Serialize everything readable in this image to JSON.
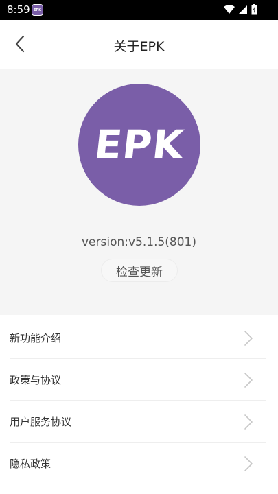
{
  "status_bar": {
    "time": "8:59",
    "app_icon_text": "EPK",
    "icons": [
      "wifi-icon",
      "signal-icon",
      "battery-icon"
    ]
  },
  "nav": {
    "title": "关于EPK",
    "back_icon": "chevron-left-icon"
  },
  "logo": {
    "text": "EPK",
    "color": "#7a5ea8"
  },
  "version": "version:v5.1.5(801)",
  "check_update_label": "检查更新",
  "menu": [
    {
      "label": "新功能介绍",
      "icon": "chevron-right-icon"
    },
    {
      "label": "政策与协议",
      "icon": "chevron-right-icon"
    },
    {
      "label": "用户服务协议",
      "icon": "chevron-right-icon"
    },
    {
      "label": "隐私政策",
      "icon": "chevron-right-icon"
    }
  ],
  "colors": {
    "accent": "#7a5ea8",
    "header_bg": "#f5f5f5",
    "status_bar_bg": "#000000"
  }
}
